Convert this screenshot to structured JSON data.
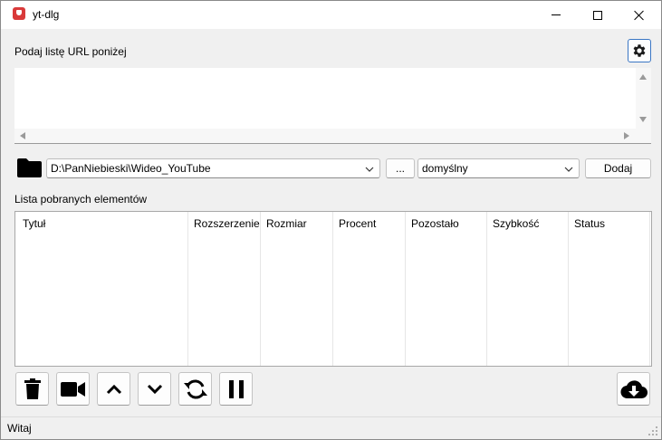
{
  "window": {
    "title": "yt-dlg"
  },
  "url_section": {
    "label": "Podaj listę URL poniżej",
    "value": ""
  },
  "toolbar": {
    "path_value": "D:\\PanNiebieski\\Wideo_YouTube",
    "browse_label": "...",
    "format_value": "domyślny",
    "add_label": "Dodaj"
  },
  "downloads": {
    "label": "Lista pobranych elementów",
    "columns": [
      "Tytuł",
      "Rozszerzenie",
      "Rozmiar",
      "Procent",
      "Pozostało",
      "Szybkość",
      "Status"
    ]
  },
  "actions": {
    "icons": [
      "trash-icon",
      "video-camera-icon",
      "chevron-up-icon",
      "chevron-down-icon",
      "refresh-icon",
      "pause-icon",
      "cloud-download-icon"
    ]
  },
  "status": {
    "text": "Witaj"
  }
}
